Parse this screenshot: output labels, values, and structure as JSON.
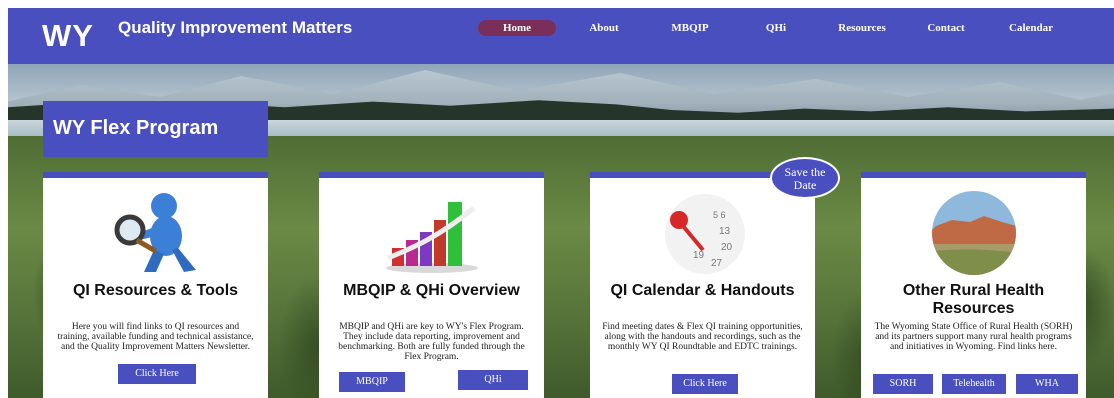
{
  "header": {
    "logo_initials": "WY",
    "logo_name": "Quality Improvement Matters",
    "nav": [
      {
        "label": "Home",
        "active": true
      },
      {
        "label": "About"
      },
      {
        "label": "MBQIP"
      },
      {
        "label": "QHi"
      },
      {
        "label": "Resources"
      },
      {
        "label": "Contact"
      },
      {
        "label": "Calendar"
      }
    ]
  },
  "hero": {
    "title": "WY Flex Program",
    "badge": "Save the Date"
  },
  "cards": [
    {
      "image": "magnifier-figure-icon",
      "title": "QI Resources & Tools",
      "description": "Here you will find links to QI resources and training, available funding and technical assistance, and the Quality Improvement Matters Newsletter.",
      "buttons": [
        "Click Here"
      ]
    },
    {
      "image": "bar-chart-icon",
      "title": "MBQIP & QHi Overview",
      "description": "MBQIP and QHi are key to WY's Flex Program. They include data reporting, improvement and benchmarking. Both are fully funded through the Flex Program.",
      "buttons": [
        "MBQIP",
        "QHi"
      ]
    },
    {
      "image": "calendar-pin-icon",
      "title": "QI Calendar & Handouts",
      "description": "Find meeting dates & Flex QI training opportunities, along with the handouts and recordings, such as the monthly WY QI Roundtable and EDTC trainings.",
      "buttons": [
        "Click Here"
      ]
    },
    {
      "image": "landscape-icon",
      "title": "Other Rural Health Resources",
      "description": "The Wyoming State Office of Rural Health (SORH) and its partners support many rural health programs and initiatives in Wyoming. Find links here.",
      "buttons": [
        "SORH",
        "Telehealth",
        "WHA"
      ]
    }
  ],
  "colors": {
    "primary": "#4a4fc0",
    "active_nav": "#7a2e5a"
  }
}
